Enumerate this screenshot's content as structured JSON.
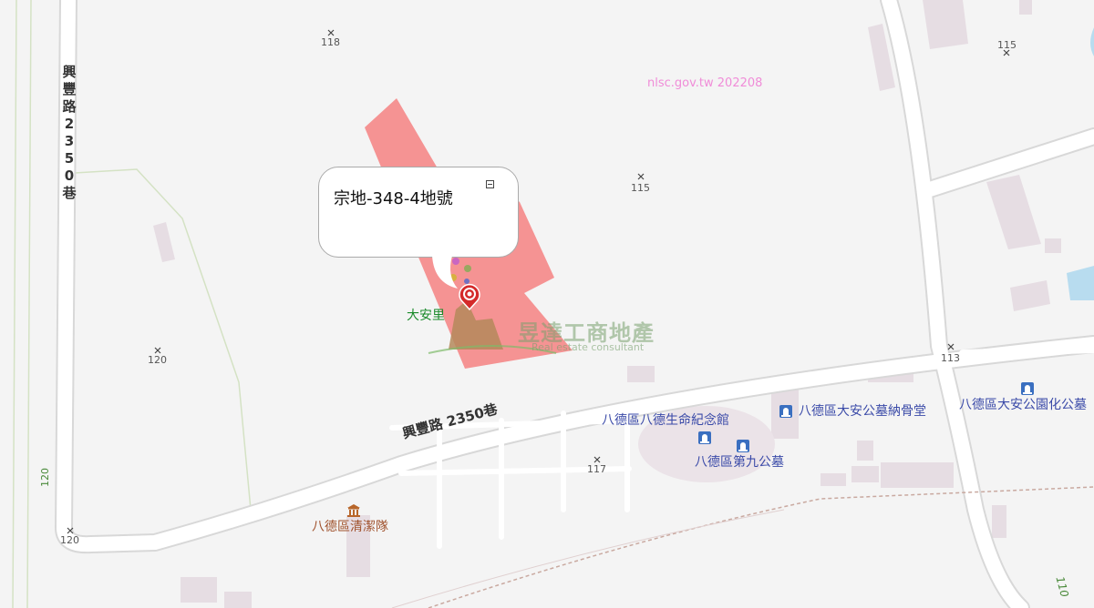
{
  "map": {
    "attribution": "nlsc.gov.tw 202208",
    "popup": {
      "title": "宗地-348-4地號"
    },
    "watermark": {
      "name": "昱達工商地產",
      "subtitle": "Real estate consultant"
    },
    "roads": {
      "left_vertical": "興豐路 2350巷",
      "lower_diagonal": "興豐路 2350巷",
      "left_edge_number": "120",
      "bottom_right_number": "110"
    },
    "elevations": [
      "118",
      "115",
      "115",
      "120",
      "113",
      "117",
      "120"
    ],
    "areas": {
      "village": "大安里"
    },
    "pois": {
      "memorial_hall": "八德區八德生命紀念館",
      "ossuary": "八德區大安公墓納骨堂",
      "cemetery_9": "八德區第九公墓",
      "park_cemetery": "八德區大安公園化公墓",
      "cleaning_team": "八德區清潔隊"
    },
    "colors": {
      "parcel": "#f48a8a",
      "road": "#ffffff",
      "building": "#e6dde3",
      "water": "#b8dcef",
      "poi_text": "#3a4aa8",
      "marker": "#d42a2a"
    },
    "icons": [
      "close-icon",
      "location-pin-icon",
      "cemetery-icon",
      "government-building-icon"
    ]
  }
}
